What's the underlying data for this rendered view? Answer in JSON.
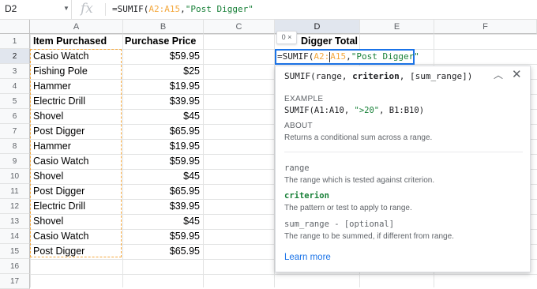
{
  "formula_bar": {
    "cell_ref": "D2",
    "fx": "fx",
    "formula": {
      "prefix": "=SUMIF(",
      "ref": "A2:A15",
      "comma": ",",
      "str": "\"Post Digger\""
    }
  },
  "columns": [
    "A",
    "B",
    "C",
    "D",
    "E",
    "F"
  ],
  "rows": [
    "1",
    "2",
    "3",
    "4",
    "5",
    "6",
    "7",
    "8",
    "9",
    "10",
    "11",
    "12",
    "13",
    "14",
    "15",
    "16",
    "17"
  ],
  "headers": {
    "item": "Item Purchased",
    "price": "Purchase Price",
    "total": "Digger Total"
  },
  "data": [
    {
      "item": "Casio Watch",
      "price": "$59.95"
    },
    {
      "item": "Fishing Pole",
      "price": "$25"
    },
    {
      "item": "Hammer",
      "price": "$19.95"
    },
    {
      "item": "Electric Drill",
      "price": "$39.95"
    },
    {
      "item": "Shovel",
      "price": "$45"
    },
    {
      "item": "Post Digger",
      "price": "$65.95"
    },
    {
      "item": "Hammer",
      "price": "$19.95"
    },
    {
      "item": "Casio Watch",
      "price": "$59.95"
    },
    {
      "item": "Shovel",
      "price": "$45"
    },
    {
      "item": "Post Digger",
      "price": "$65.95"
    },
    {
      "item": "Electric Drill",
      "price": "$39.95"
    },
    {
      "item": "Shovel",
      "price": "$45"
    },
    {
      "item": "Casio Watch",
      "price": "$59.95"
    },
    {
      "item": "Post Digger",
      "price": "$65.95"
    }
  ],
  "edit_cell": {
    "prefix": "=SUMIF(",
    "ref_a": "A2:",
    "ref_b": "A15",
    "comma": ",",
    "str": "\"Post Digger\""
  },
  "badge": "0 ×",
  "popup": {
    "sig_prefix": "SUMIF(range, ",
    "sig_active": "criterion",
    "sig_suffix": ", [sum_range])",
    "example_label": "EXAMPLE",
    "example_prefix": "SUMIF(A1:A10, ",
    "example_str": "\">20\"",
    "example_suffix": ", B1:B10)",
    "about_label": "ABOUT",
    "about_text": "Returns a conditional sum across a range.",
    "params": [
      {
        "name": "range",
        "desc": "The range which is tested against criterion."
      },
      {
        "name": "criterion",
        "desc": "The pattern or test to apply to range."
      },
      {
        "name": "sum_range - [optional]",
        "desc": "The range to be summed, if different from range."
      }
    ],
    "learn_more": "Learn more"
  },
  "colors": {
    "accent": "#1a73e8",
    "range_highlight": "#f4a83e",
    "string": "#188038"
  }
}
